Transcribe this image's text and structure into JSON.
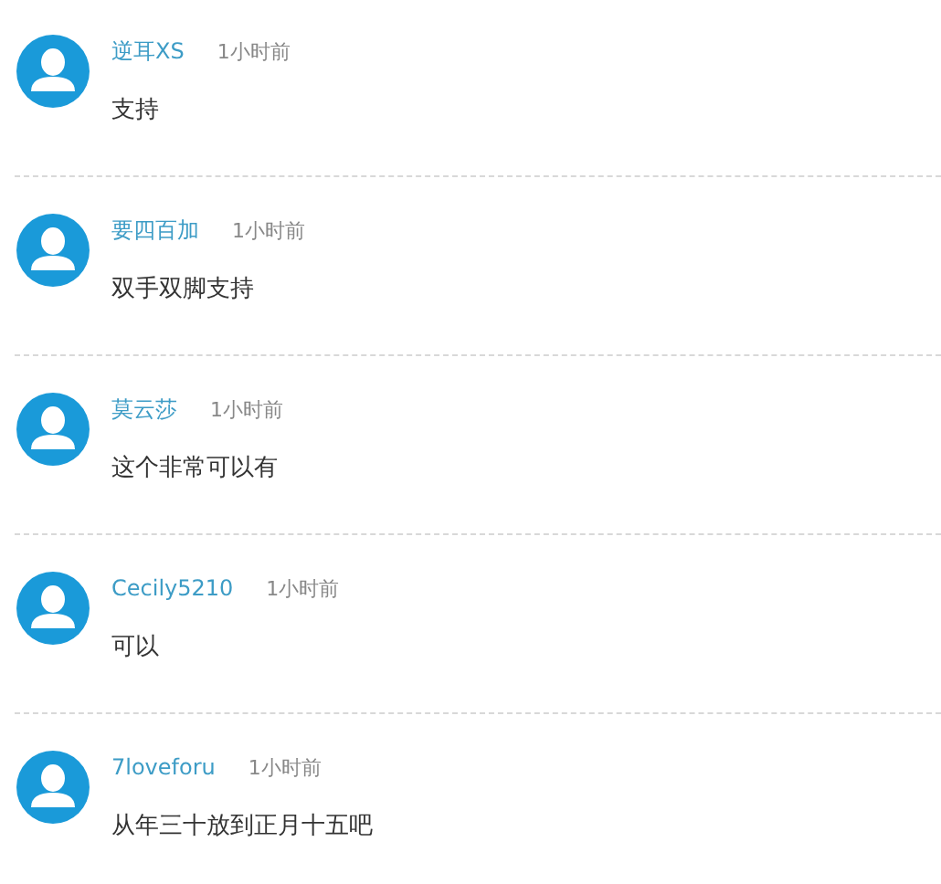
{
  "comments": [
    {
      "user": "逆耳XS",
      "time": "1小时前",
      "text": "支持"
    },
    {
      "user": "要四百加",
      "time": "1小时前",
      "text": "双手双脚支持"
    },
    {
      "user": "莫云莎",
      "time": "1小时前",
      "text": "这个非常可以有"
    },
    {
      "user": "Cecily5210",
      "time": "1小时前",
      "text": "可以"
    },
    {
      "user": "7loveforu",
      "time": "1小时前",
      "text": "从年三十放到正月十五吧"
    }
  ]
}
